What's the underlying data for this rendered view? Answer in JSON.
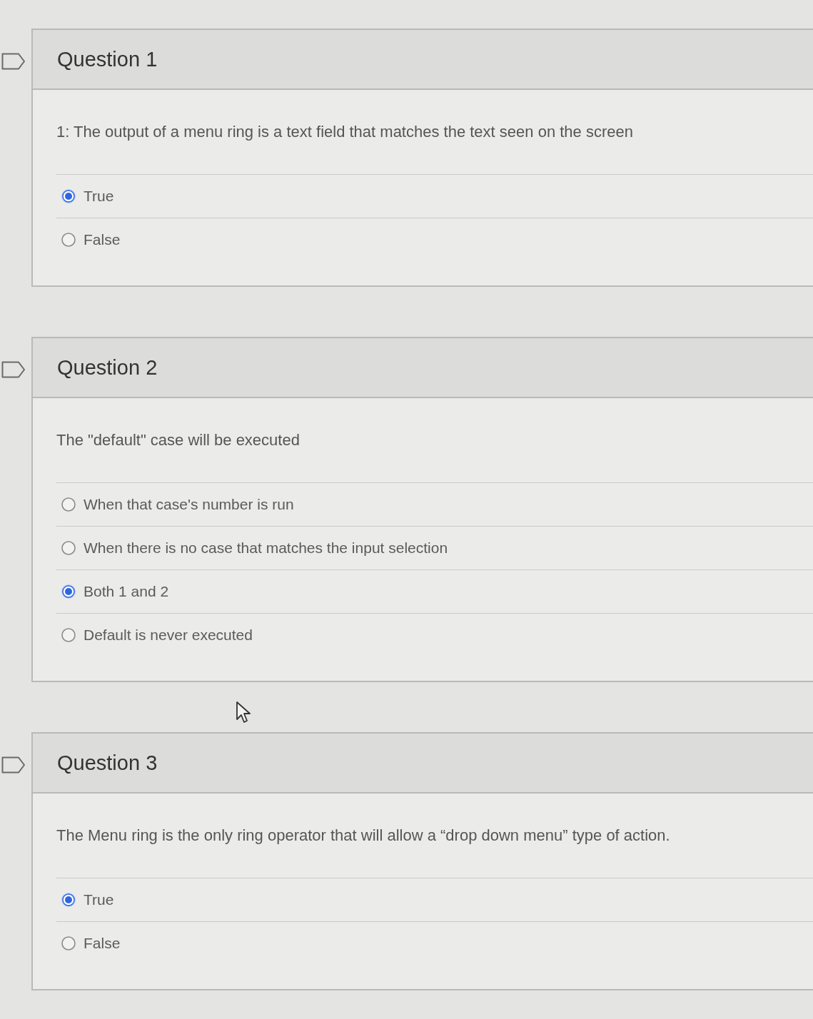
{
  "questions": [
    {
      "title": "Question 1",
      "text": "1: The output of a menu ring is a text field that matches the text seen on the screen",
      "options": [
        {
          "label": "True",
          "selected": true
        },
        {
          "label": "False",
          "selected": false
        }
      ]
    },
    {
      "title": "Question 2",
      "text": "The \"default\" case will be executed",
      "options": [
        {
          "label": "When that case's number is run",
          "selected": false
        },
        {
          "label": "When there is no case that matches the input selection",
          "selected": false
        },
        {
          "label": "Both 1 and 2",
          "selected": true
        },
        {
          "label": "Default is never executed",
          "selected": false
        }
      ]
    },
    {
      "title": "Question 3",
      "text": "The Menu ring is the only ring operator that will allow a “drop down menu” type of action.",
      "options": [
        {
          "label": "True",
          "selected": true
        },
        {
          "label": "False",
          "selected": false
        }
      ]
    }
  ]
}
